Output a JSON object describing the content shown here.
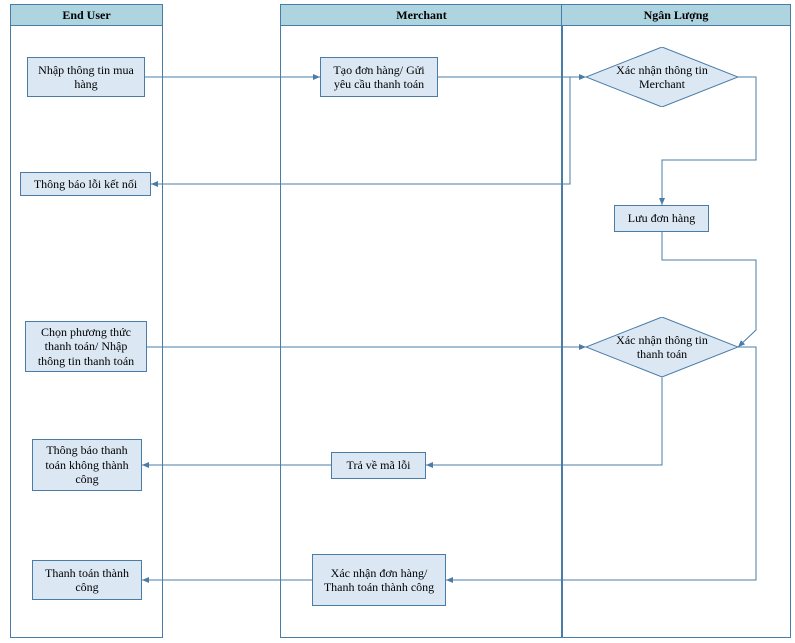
{
  "lanes": {
    "end_user": "End User",
    "merchant": "Merchant",
    "ngan_luong": "Ngân Lượng"
  },
  "nodes": {
    "enter_purchase_info": "Nhập thông tin mua hàng",
    "create_order": "Tạo đơn hàng/ Gửi yêu cầu thanh toán",
    "verify_merchant": "Xác nhận thông tin Merchant",
    "connection_error": "Thông báo lỗi kết nối",
    "save_order": "Lưu đơn hàng",
    "choose_payment": "Chọn phương thức thanh toán/  Nhập thông tin thanh toán",
    "verify_payment": "Xác nhận thông tin thanh toán",
    "return_error": "Trả về mã lỗi",
    "payment_failed": "Thông báo thanh toán không thành công",
    "confirm_success": "Xác nhận đơn hàng/ Thanh  toán thành công",
    "payment_success": "Thanh toán thành công"
  }
}
